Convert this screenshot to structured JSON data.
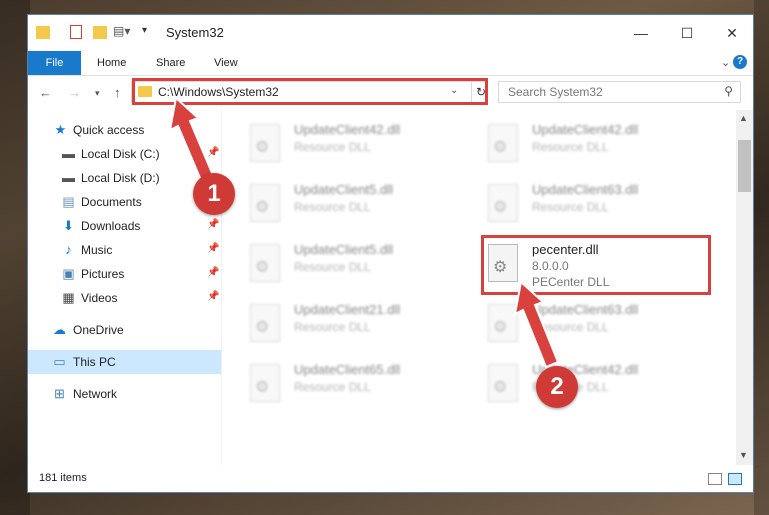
{
  "window": {
    "title": "System32"
  },
  "ribbon": {
    "file": "File",
    "home": "Home",
    "share": "Share",
    "view": "View",
    "help": "?"
  },
  "nav": {
    "address": "C:\\Windows\\System32",
    "search_placeholder": "Search System32"
  },
  "sidebar": {
    "items": [
      {
        "label": "Quick access",
        "icon": "star-icon"
      },
      {
        "label": "Local Disk (C:)",
        "icon": "drive-icon",
        "pinned": true
      },
      {
        "label": "Local Disk (D:)",
        "icon": "drive-icon"
      },
      {
        "label": "Documents",
        "icon": "documents-icon",
        "pinned": true
      },
      {
        "label": "Downloads",
        "icon": "download-icon",
        "pinned": true
      },
      {
        "label": "Music",
        "icon": "music-icon",
        "pinned": true
      },
      {
        "label": "Pictures",
        "icon": "pictures-icon",
        "pinned": true
      },
      {
        "label": "Videos",
        "icon": "videos-icon",
        "pinned": true
      },
      {
        "label": "OneDrive",
        "icon": "cloud-icon"
      },
      {
        "label": "This PC",
        "icon": "computer-icon",
        "selected": true
      },
      {
        "label": "Network",
        "icon": "network-icon"
      }
    ]
  },
  "files": [
    {
      "name": "UpdateClient42.dll",
      "line1": "Resource DLL",
      "line2": ""
    },
    {
      "name": "UpdateClient42.dll",
      "line1": "Resource DLL",
      "line2": ""
    },
    {
      "name": "UpdateClient5.dll",
      "line1": "Resource DLL",
      "line2": ""
    },
    {
      "name": "UpdateClient63.dll",
      "line1": "Resource DLL",
      "line2": ""
    },
    {
      "name": "UpdateClient5.dll",
      "line1": "Resource DLL",
      "line2": ""
    },
    {
      "name": "pecenter.dll",
      "line1": "8.0.0.0",
      "line2": "PECenter DLL"
    },
    {
      "name": "UpdateClient21.dll",
      "line1": "Resource DLL",
      "line2": ""
    },
    {
      "name": "UpdateClient63.dll",
      "line1": "Resource DLL",
      "line2": ""
    },
    {
      "name": "UpdateClient65.dll",
      "line1": "Resource DLL",
      "line2": ""
    },
    {
      "name": "UpdateClient42.dll",
      "line1": "Resource DLL",
      "line2": ""
    }
  ],
  "status": {
    "items": "181 items"
  },
  "annotations": {
    "step1": "1",
    "step2": "2"
  },
  "colors": {
    "highlight": "#d9413f",
    "accent": "#1979ca",
    "selection": "#cce8ff"
  }
}
